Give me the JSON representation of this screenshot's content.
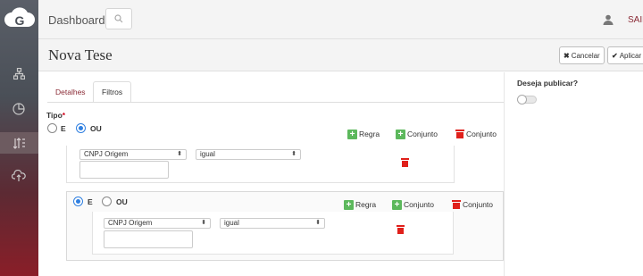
{
  "sidebar": {
    "logo_icon": "logo-g-icon",
    "items": [
      {
        "icon": "sitemap-icon"
      },
      {
        "icon": "pie-chart-icon"
      },
      {
        "icon": "sort-icon",
        "active": true
      },
      {
        "icon": "cloud-upload-icon"
      }
    ]
  },
  "topbar": {
    "title": "Dashboard",
    "logout": "SAIR"
  },
  "header": {
    "title": "Nova Tese",
    "cancel_label": "Cancelar",
    "apply_label": "Aplicar"
  },
  "tabs": [
    {
      "label": "Detalhes"
    },
    {
      "label": "Filtros"
    }
  ],
  "filter": {
    "type_label": "Tipo",
    "required_mark": "*",
    "option_e": "E",
    "option_ou": "OU",
    "add_rule": "Regra",
    "add_group": "Conjunto",
    "delete_group": "Conjunto",
    "rule": {
      "field": "CNPJ Origem",
      "operator": "igual",
      "value": ""
    }
  },
  "group2": {
    "option_e": "E",
    "option_ou": "OU",
    "add_rule": "Regra",
    "add_group": "Conjunto",
    "delete_group": "Conjunto",
    "rule": {
      "field": "CNPJ Origem",
      "operator": "igual",
      "value": ""
    }
  },
  "right_panel": {
    "publish_label": "Deseja publicar?",
    "publish_on": false
  }
}
